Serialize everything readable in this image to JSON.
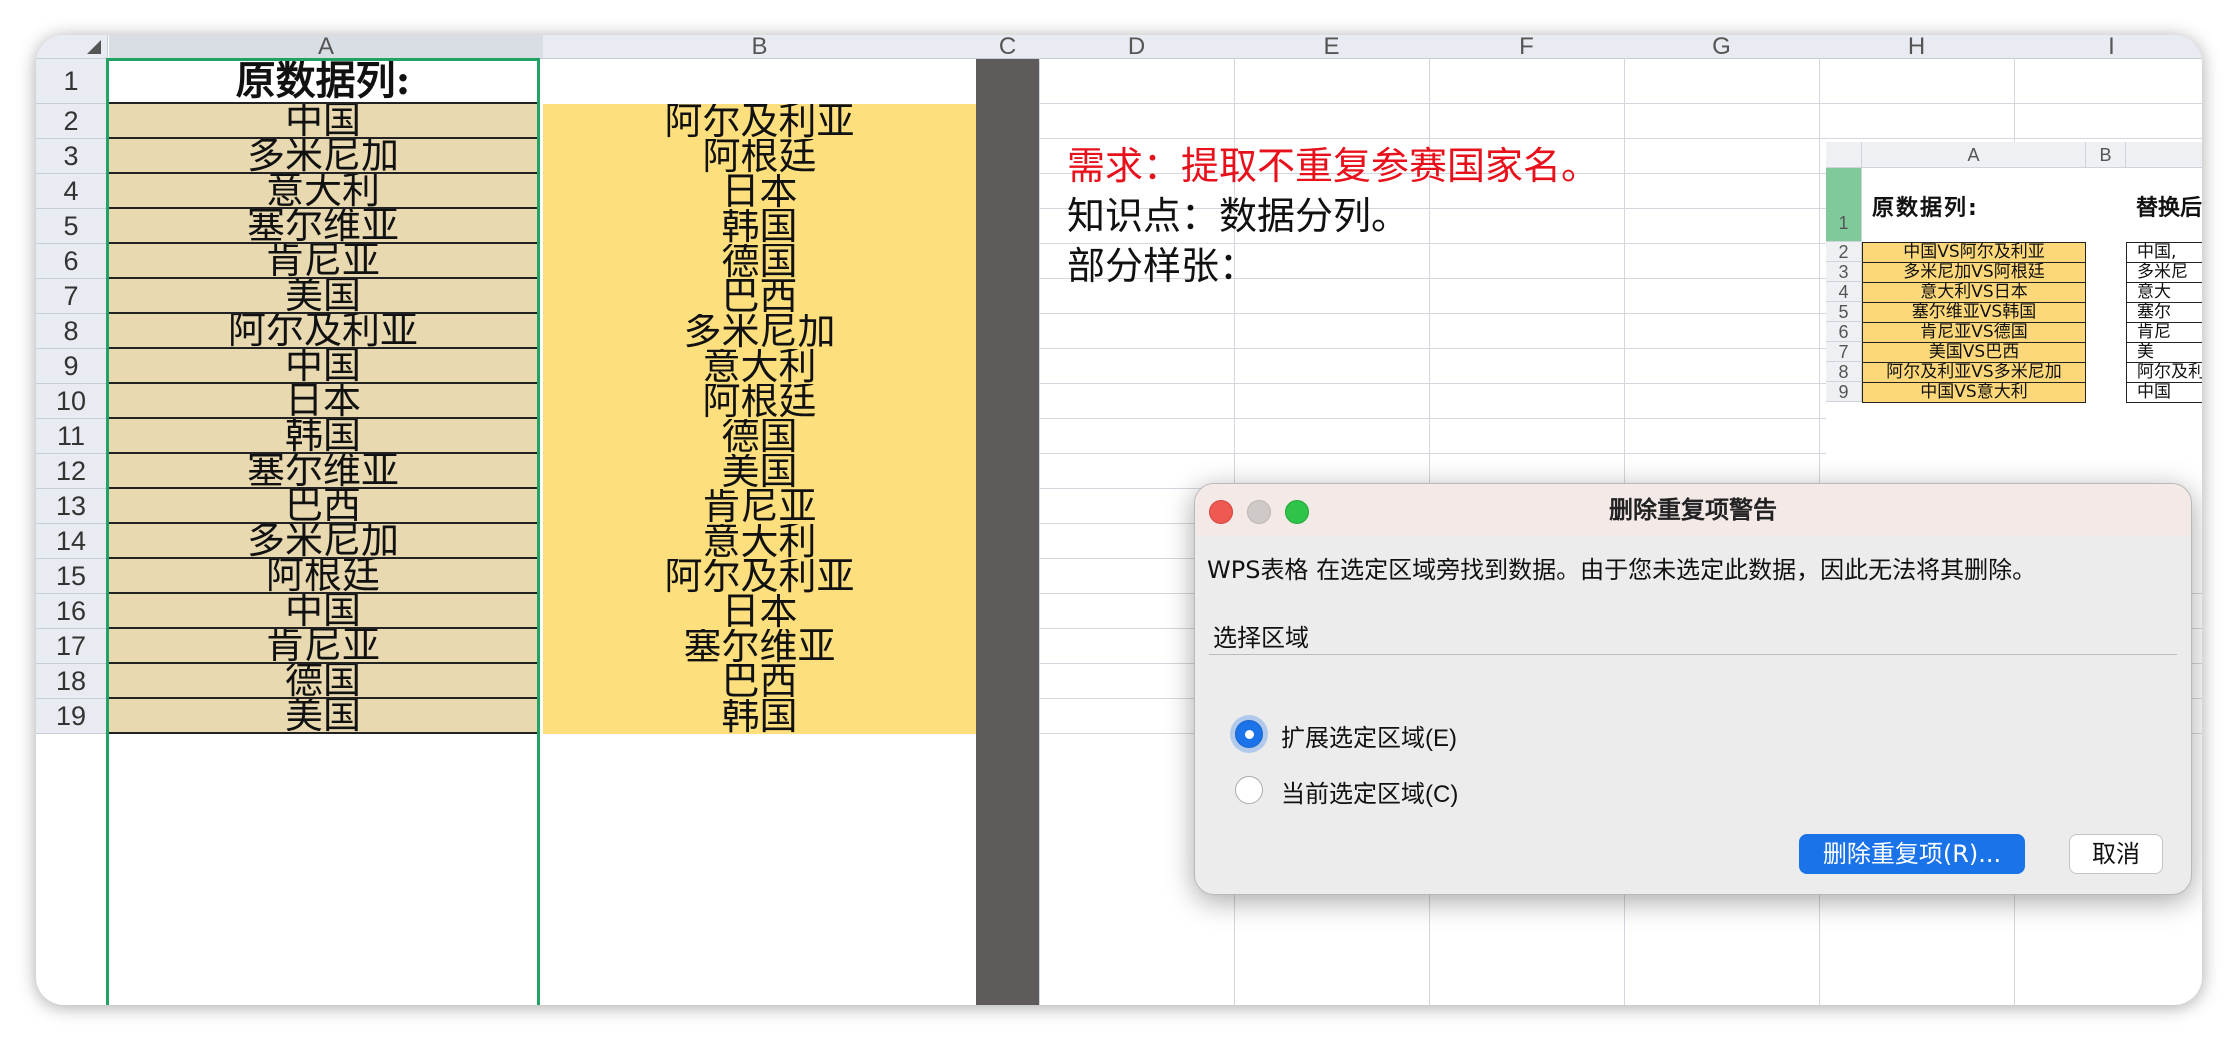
{
  "columns": [
    "A",
    "B",
    "C",
    "D",
    "E",
    "F",
    "G",
    "H",
    "I"
  ],
  "rows": [
    "1",
    "2",
    "3",
    "4",
    "5",
    "6",
    "7",
    "8",
    "9",
    "10",
    "11",
    "12",
    "13",
    "14",
    "15",
    "16",
    "17",
    "18",
    "19"
  ],
  "colA": [
    "原数据列:",
    "中国",
    "多米尼加",
    "意大利",
    "塞尔维亚",
    "肯尼亚",
    "美国",
    "阿尔及利亚",
    "中国",
    "日本",
    "韩国",
    "塞尔维亚",
    "巴西",
    "多米尼加",
    "阿根廷",
    "中国",
    "肯尼亚",
    "德国",
    "美国"
  ],
  "colB": [
    "",
    "阿尔及利亚",
    "阿根廷",
    "日本",
    "韩国",
    "德国",
    "巴西",
    "多米尼加",
    "意大利",
    "阿根廷",
    "德国",
    "美国",
    "肯尼亚",
    "意大利",
    "阿尔及利亚",
    "日本",
    "塞尔维亚",
    "巴西",
    "韩国"
  ],
  "notes": {
    "requirement": "需求：提取不重复参赛国家名。",
    "knowledge": "知识点：数据分列。",
    "sample": "部分样张："
  },
  "mini": {
    "col_a": "A",
    "col_b": "B",
    "header_a": "原数据列:",
    "header_c": "替换后",
    "rows": [
      "1",
      "2",
      "3",
      "4",
      "5",
      "6",
      "7",
      "8",
      "9"
    ],
    "a_values": [
      "中国VS阿尔及利亚",
      "多米尼加VS阿根廷",
      "意大利VS日本",
      "塞尔维亚VS韩国",
      "肯尼亚VS德国",
      "美国VS巴西",
      "阿尔及利亚VS多米尼加",
      "中国VS意大利"
    ],
    "c_values": [
      "中国,",
      "多米尼",
      "意大",
      "塞尔",
      "肯尼",
      "美",
      "阿尔及利",
      "中国"
    ]
  },
  "dialog": {
    "title": "删除重复项警告",
    "message": "WPS表格 在选定区域旁找到数据。由于您未选定此数据，因此无法将其删除。",
    "section_label": "选择区域",
    "option_expand": "扩展选定区域(E)",
    "option_current": "当前选定区域(C)",
    "expand_selected": true,
    "remove_button": "删除重复项(R)...",
    "cancel_button": "取消"
  },
  "colors": {
    "colA_fill": "#e8d9b0",
    "colB_fill": "#fde07d",
    "colC_fill": "#5f5b5b",
    "requirement_text": "#e8101a",
    "selection_border": "#21a366",
    "primary_button": "#1a73e8"
  }
}
